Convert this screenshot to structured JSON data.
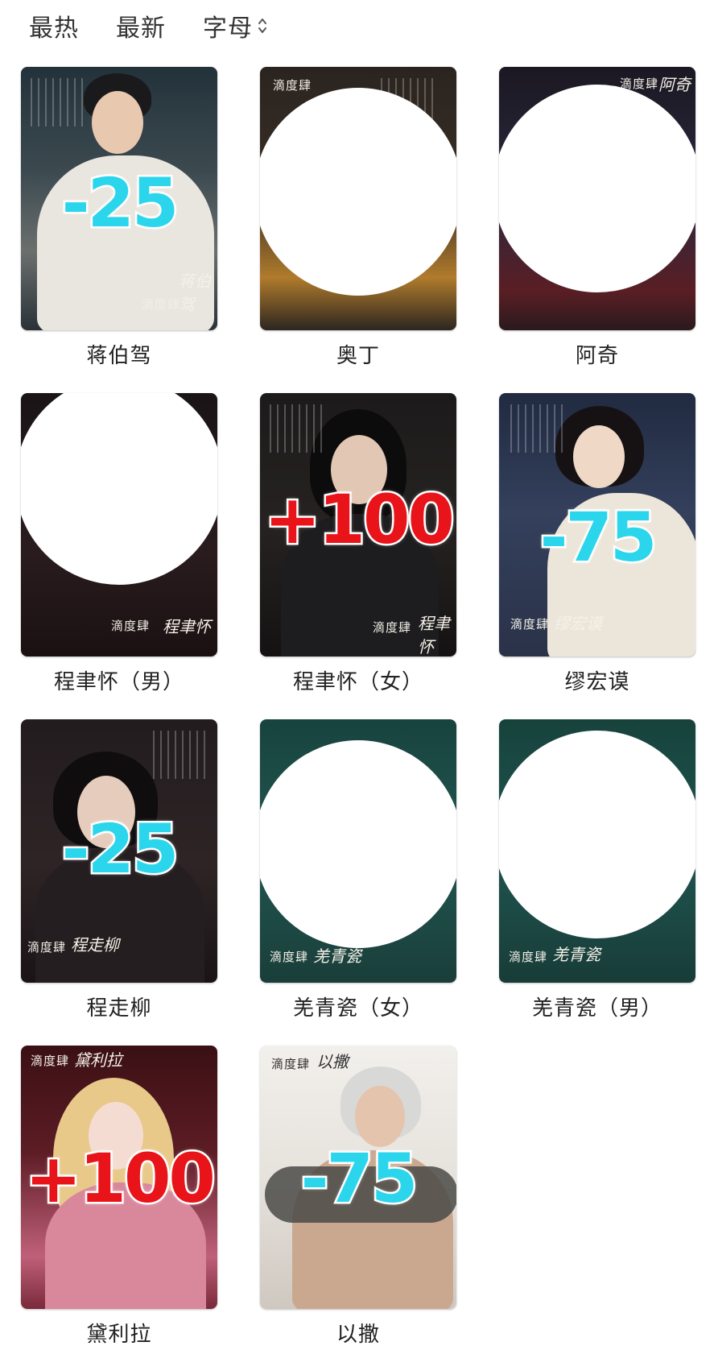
{
  "tabs": {
    "hot": "最热",
    "newest": "最新",
    "alpha": "字母",
    "sort_icon": "sort-updown-icon"
  },
  "poster_logo": "滴度肆",
  "cards": [
    {
      "name": "蒋伯驾",
      "score": "-25",
      "signature": "蒋伯驾"
    },
    {
      "name": "奥丁",
      "score": "",
      "signature": ""
    },
    {
      "name": "阿奇",
      "score": "",
      "signature": "阿奇"
    },
    {
      "name": "程聿怀（男）",
      "score": "",
      "signature": "程聿怀"
    },
    {
      "name": "程聿怀（女）",
      "score": "+100",
      "signature": "程聿怀"
    },
    {
      "name": "缪宏谟",
      "score": "-75",
      "signature": "缪宏谟"
    },
    {
      "name": "程走柳",
      "score": "-25",
      "signature": "程走柳"
    },
    {
      "name": "羌青瓷（女）",
      "score": "",
      "signature": "羌青瓷"
    },
    {
      "name": "羌青瓷（男）",
      "score": "",
      "signature": "羌青瓷"
    },
    {
      "name": "黛利拉",
      "score": "+100",
      "signature": "黛利拉"
    },
    {
      "name": "以撒",
      "score": "-75",
      "signature": "以撒"
    }
  ],
  "colors": {
    "score_negative": "#2bd6ec",
    "score_positive": "#e8141a"
  }
}
